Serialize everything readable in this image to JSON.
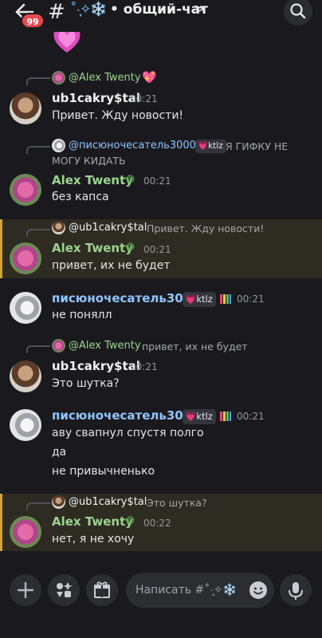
{
  "header": {
    "badge": "99",
    "hash": "#",
    "deco": "˚·̩͙✧❄️",
    "title": "• общий-чат",
    "chevron": ">"
  },
  "messages": [
    {
      "reply_name": "@Alex Twenty",
      "reply_text": "",
      "author": "ub1cakry$tal",
      "time": "00:21",
      "lines": [
        "Привет. Жду новости!"
      ]
    },
    {
      "reply_name": "@писюночесатель3000",
      "reply_tag": "ktlz",
      "reply_text": "Я ГИФКУ НЕ",
      "reply_text2": "МОГУ КИДАТЬ",
      "author": "Alex Twenty",
      "time": "00:21",
      "lines": [
        "без капса"
      ]
    },
    {
      "reply_name": "@ub1cakry$tal",
      "reply_text": "Привет. Жду новости!",
      "author": "Alex Twenty",
      "time": "00:21",
      "lines": [
        "привет, их не будет"
      ]
    },
    {
      "author": "писюночесатель3000",
      "tag": "ktlz",
      "time": "00:21",
      "lines": [
        "не понялл"
      ]
    },
    {
      "reply_name": "@Alex Twenty",
      "reply_text": "привет, их не будет",
      "author": "ub1cakry$tal",
      "time": "00:21",
      "lines": [
        "Это шутка?"
      ]
    },
    {
      "author": "писюночесатель3000",
      "tag": "ktlz",
      "time": "00:21",
      "lines": [
        "аву свапнул спустя полго",
        "да",
        "не привычненько"
      ]
    },
    {
      "reply_name": "@ub1cakry$tal",
      "reply_text": "Это шутка?",
      "author": "Alex Twenty",
      "time": "00:22",
      "lines": [
        "нет, я не хочу"
      ]
    }
  ],
  "composer": {
    "placeholder": "Написать #˚·̩͙✧❄️"
  },
  "icons": [
    "back-arrow-icon",
    "hash-icon",
    "search-icon",
    "plus-icon",
    "apps-icon",
    "gift-icon",
    "emoji-icon",
    "mic-icon",
    "heart-icon",
    "wreath-icon"
  ],
  "colors": {
    "background": "#1a1a1e",
    "highlight": "#2e2b22",
    "highlight_bar": "#d4a331",
    "badge": "#e5484d",
    "alex": "#9bd58e",
    "pis": "#8fc5ff"
  }
}
